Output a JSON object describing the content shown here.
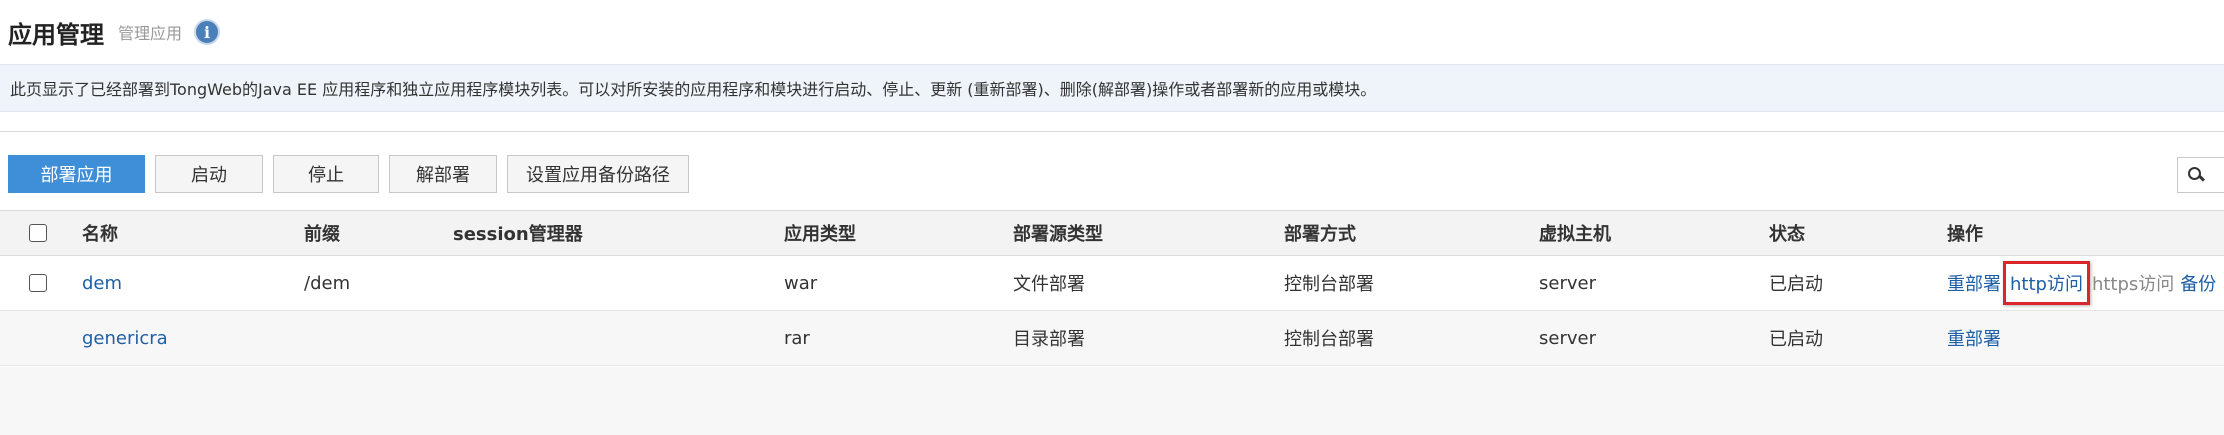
{
  "header": {
    "title": "应用管理",
    "subtitle": "管理应用",
    "info_icon": "i"
  },
  "description": "此页显示了已经部署到TongWeb的Java EE 应用程序和独立应用程序模块列表。可以对所安装的应用程序和模块进行启动、停止、更新 (重新部署)、删除(解部署)操作或者部署新的应用或模块。",
  "toolbar": {
    "deploy_label": "部署应用",
    "start_label": "启动",
    "stop_label": "停止",
    "undeploy_label": "解部署",
    "backup_path_label": "设置应用备份路径"
  },
  "table": {
    "headers": {
      "name": "名称",
      "prefix": "前缀",
      "session": "session管理器",
      "app_type": "应用类型",
      "source_type": "部署源类型",
      "deploy_mode": "部署方式",
      "vhost": "虚拟主机",
      "status": "状态",
      "ops": "操作"
    },
    "rows": [
      {
        "name": "dem",
        "prefix": "/dem",
        "session": "",
        "app_type": "war",
        "source_type": "文件部署",
        "deploy_mode": "控制台部署",
        "vhost": "server",
        "status": "已启动",
        "ops": {
          "redeploy": "重部署",
          "http": "http访问",
          "https": "https访问",
          "backup": "备份"
        }
      },
      {
        "name": "genericra",
        "prefix": "",
        "session": "",
        "app_type": "rar",
        "source_type": "目录部署",
        "deploy_mode": "控制台部署",
        "vhost": "server",
        "status": "已启动",
        "ops": {
          "redeploy": "重部署"
        }
      }
    ]
  },
  "colors": {
    "primary": "#3e8ed8",
    "link": "#1e5fa6",
    "highlight": "#d9262b",
    "desc_bg": "#eef4f9"
  }
}
